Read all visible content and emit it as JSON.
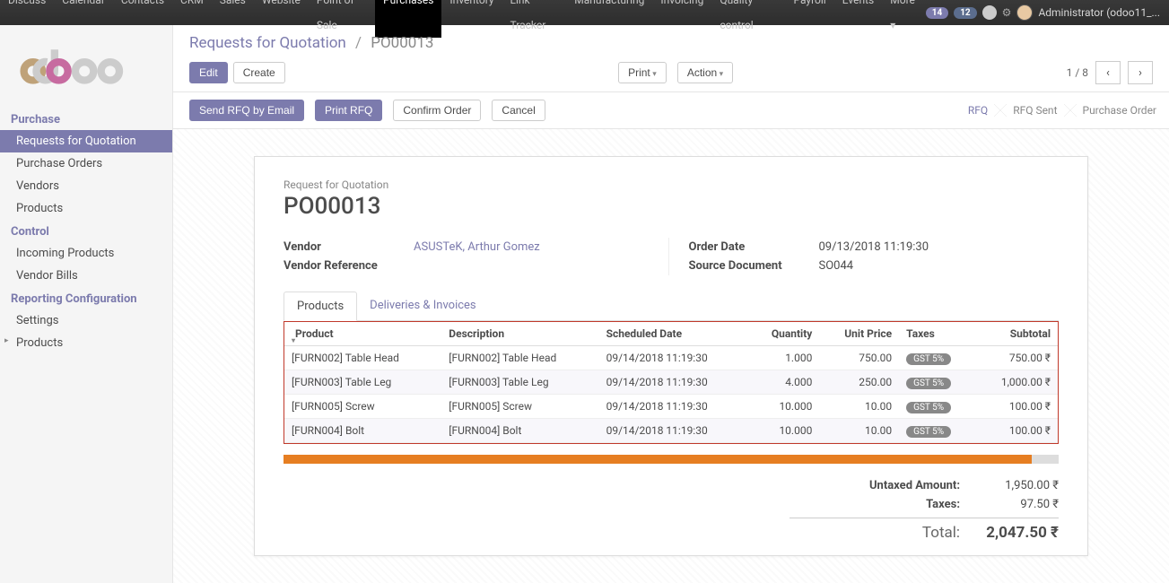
{
  "topnav": {
    "items": [
      "Discuss",
      "Calendar",
      "Contacts",
      "CRM",
      "Sales",
      "Website",
      "Point of Sale",
      "Purchases",
      "Inventory",
      "Link Tracker",
      "Manufacturing",
      "Invoicing",
      "Quality control",
      "Payroll",
      "Events",
      "More ▾"
    ],
    "active_index": 7,
    "badge1": "14",
    "badge2": "12",
    "user": "Administrator (odoo11_..."
  },
  "sidebar": {
    "sections": [
      {
        "title": "Purchase",
        "items": [
          "Requests for Quotation",
          "Purchase Orders",
          "Vendors",
          "Products"
        ],
        "active_index": 0
      },
      {
        "title": "Control",
        "items": [
          "Incoming Products",
          "Vendor Bills"
        ]
      },
      {
        "title": "Reporting Configuration",
        "items": [
          "Settings",
          "Products"
        ],
        "caret_index": 1
      }
    ]
  },
  "breadcrumb": {
    "link": "Requests for Quotation",
    "current": "PO00013",
    "sep": "/"
  },
  "buttons": {
    "edit": "Edit",
    "create": "Create",
    "print": "Print",
    "action": "Action"
  },
  "pager": {
    "text": "1 / 8"
  },
  "actions": {
    "send_rfq": "Send RFQ by Email",
    "print_rfq": "Print RFQ",
    "confirm": "Confirm Order",
    "cancel": "Cancel"
  },
  "status": {
    "rfq": "RFQ",
    "rfq_sent": "RFQ Sent",
    "po": "Purchase Order"
  },
  "sheet": {
    "subtitle": "Request for Quotation",
    "title": "PO00013",
    "vendor_label": "Vendor",
    "vendor": "ASUSTeK, Arthur Gomez",
    "vendor_ref_label": "Vendor Reference",
    "vendor_ref": "",
    "order_date_label": "Order Date",
    "order_date": "09/13/2018 11:19:30",
    "source_doc_label": "Source Document",
    "source_doc": "SO044"
  },
  "tabs": {
    "products": "Products",
    "deliveries": "Deliveries & Invoices"
  },
  "table": {
    "headers": {
      "product": "Product",
      "description": "Description",
      "scheduled": "Scheduled Date",
      "qty": "Quantity",
      "unit_price": "Unit Price",
      "taxes": "Taxes",
      "subtotal": "Subtotal"
    },
    "rows": [
      {
        "product": "[FURN002] Table Head",
        "desc": "[FURN002] Table Head",
        "date": "09/14/2018 11:19:30",
        "qty": "1.000",
        "price": "750.00",
        "tax": "GST 5%",
        "subtotal": "750.00 ₹"
      },
      {
        "product": "[FURN003] Table Leg",
        "desc": "[FURN003] Table Leg",
        "date": "09/14/2018 11:19:30",
        "qty": "4.000",
        "price": "250.00",
        "tax": "GST 5%",
        "subtotal": "1,000.00 ₹"
      },
      {
        "product": "[FURN005] Screw",
        "desc": "[FURN005] Screw",
        "date": "09/14/2018 11:19:30",
        "qty": "10.000",
        "price": "10.00",
        "tax": "GST 5%",
        "subtotal": "100.00 ₹"
      },
      {
        "product": "[FURN004] Bolt",
        "desc": "[FURN004] Bolt",
        "date": "09/14/2018 11:19:30",
        "qty": "10.000",
        "price": "10.00",
        "tax": "GST 5%",
        "subtotal": "100.00 ₹"
      }
    ]
  },
  "totals": {
    "untaxed_label": "Untaxed Amount:",
    "untaxed": "1,950.00 ₹",
    "taxes_label": "Taxes:",
    "taxes": "97.50 ₹",
    "total_label": "Total:",
    "total": "2,047.50 ₹"
  }
}
